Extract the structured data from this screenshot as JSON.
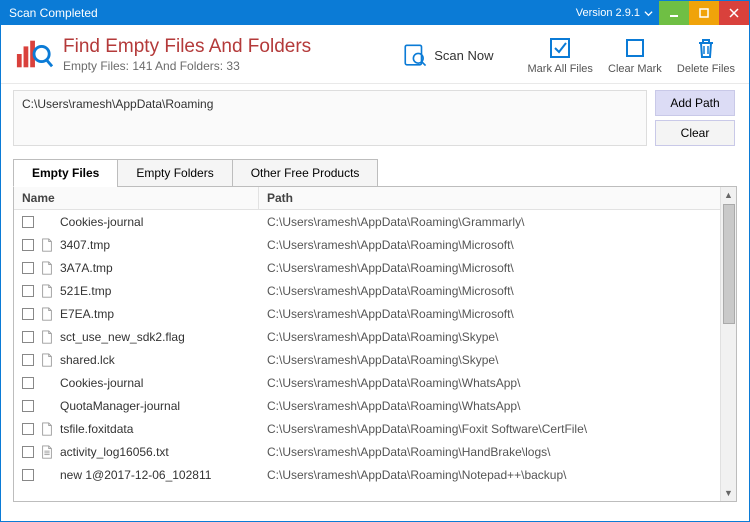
{
  "titlebar": {
    "title": "Scan Completed",
    "version": "Version 2.9.1"
  },
  "header": {
    "app_title": "Find Empty Files And Folders",
    "summary": "Empty Files: 141 And Folders: 33"
  },
  "actions": {
    "scan_now": "Scan Now",
    "mark_all": "Mark All Files",
    "clear_mark": "Clear Mark",
    "delete_files": "Delete Files"
  },
  "path": {
    "current": "C:\\Users\\ramesh\\AppData\\Roaming",
    "add_btn": "Add Path",
    "clear_btn": "Clear"
  },
  "tabs": {
    "empty_files": "Empty Files",
    "empty_folders": "Empty Folders",
    "other": "Other Free Products"
  },
  "list": {
    "head_name": "Name",
    "head_path": "Path",
    "rows": [
      {
        "icon": "none",
        "name": "Cookies-journal",
        "path": "C:\\Users\\ramesh\\AppData\\Roaming\\Grammarly\\"
      },
      {
        "icon": "file",
        "name": "3407.tmp",
        "path": "C:\\Users\\ramesh\\AppData\\Roaming\\Microsoft\\"
      },
      {
        "icon": "file",
        "name": "3A7A.tmp",
        "path": "C:\\Users\\ramesh\\AppData\\Roaming\\Microsoft\\"
      },
      {
        "icon": "file",
        "name": "521E.tmp",
        "path": "C:\\Users\\ramesh\\AppData\\Roaming\\Microsoft\\"
      },
      {
        "icon": "file",
        "name": "E7EA.tmp",
        "path": "C:\\Users\\ramesh\\AppData\\Roaming\\Microsoft\\"
      },
      {
        "icon": "file",
        "name": "sct_use_new_sdk2.flag",
        "path": "C:\\Users\\ramesh\\AppData\\Roaming\\Skype\\"
      },
      {
        "icon": "file",
        "name": "shared.lck",
        "path": "C:\\Users\\ramesh\\AppData\\Roaming\\Skype\\"
      },
      {
        "icon": "none",
        "name": "Cookies-journal",
        "path": "C:\\Users\\ramesh\\AppData\\Roaming\\WhatsApp\\"
      },
      {
        "icon": "none",
        "name": "QuotaManager-journal",
        "path": "C:\\Users\\ramesh\\AppData\\Roaming\\WhatsApp\\"
      },
      {
        "icon": "file",
        "name": "tsfile.foxitdata",
        "path": "C:\\Users\\ramesh\\AppData\\Roaming\\Foxit Software\\CertFile\\"
      },
      {
        "icon": "text",
        "name": "activity_log16056.txt",
        "path": "C:\\Users\\ramesh\\AppData\\Roaming\\HandBrake\\logs\\"
      },
      {
        "icon": "none",
        "name": "new 1@2017-12-06_102811",
        "path": "C:\\Users\\ramesh\\AppData\\Roaming\\Notepad++\\backup\\"
      }
    ]
  }
}
